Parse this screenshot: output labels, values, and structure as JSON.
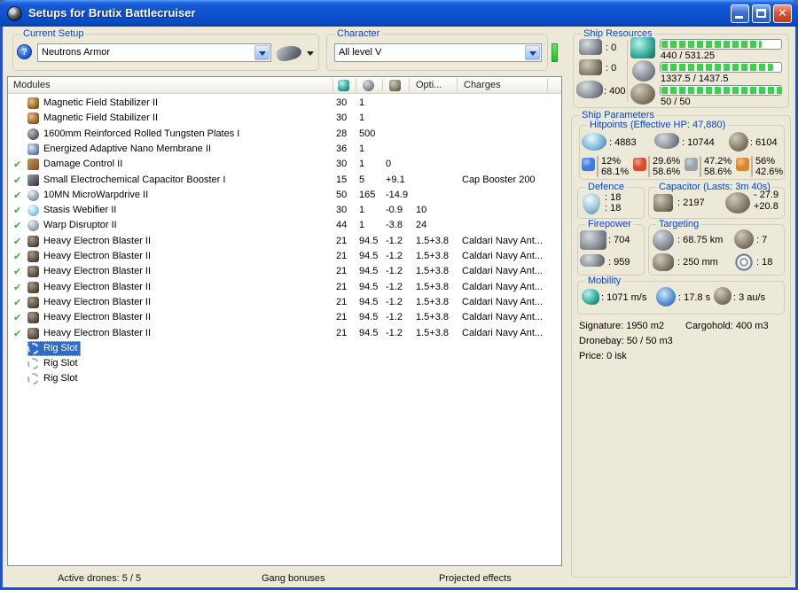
{
  "colors": {
    "selection": "#316ac5",
    "bar_green": "#3ed04a",
    "titlebar_blue": "#0f52d0",
    "close_red": "#dd5436",
    "indicator_green": "#2fd432"
  },
  "titlebar": {
    "title": "Setups for Brutix Battlecruiser"
  },
  "current_setup": {
    "label": "Current Setup",
    "value": "Neutrons Armor"
  },
  "character": {
    "label": "Character",
    "value": "All level V"
  },
  "modules": {
    "title": "Modules",
    "columns": {
      "opti": "Opti...",
      "charges": "Charges"
    },
    "rows": [
      {
        "icon": "magnetic-field-stabilizer",
        "name": "Magnetic Field Stabilizer II",
        "cpu": "30",
        "pg": "1",
        "active": false
      },
      {
        "icon": "magnetic-field-stabilizer",
        "name": "Magnetic Field Stabilizer II",
        "cpu": "30",
        "pg": "1",
        "active": false
      },
      {
        "icon": "armor-plate",
        "name": "1600mm Reinforced Rolled Tungsten Plates I",
        "cpu": "28",
        "pg": "500",
        "active": false
      },
      {
        "icon": "energized-membrane",
        "name": "Energized Adaptive Nano Membrane II",
        "cpu": "36",
        "pg": "1",
        "active": false
      },
      {
        "icon": "damage-control",
        "name": "Damage Control II",
        "cpu": "30",
        "pg": "1",
        "cap": "0",
        "active": true
      },
      {
        "icon": "cap-booster",
        "name": "Small Electrochemical Capacitor Booster I",
        "cpu": "15",
        "pg": "5",
        "cap": "+9.1",
        "charges": "Cap Booster 200",
        "active": true
      },
      {
        "icon": "microwarpdrive",
        "name": "10MN MicroWarpdrive II",
        "cpu": "50",
        "pg": "165",
        "cap": "-14.9",
        "active": true
      },
      {
        "icon": "stasis-webifier",
        "name": "Stasis Webifier II",
        "cpu": "30",
        "pg": "1",
        "cap": "-0.9",
        "opti": "10",
        "active": true
      },
      {
        "icon": "warp-disruptor",
        "name": "Warp Disruptor II",
        "cpu": "44",
        "pg": "1",
        "cap": "-3.8",
        "opti": "24",
        "active": true
      },
      {
        "icon": "blaster",
        "name": "Heavy Electron Blaster II",
        "cpu": "21",
        "pg": "94.5",
        "cap": "-1.2",
        "opti": "1.5+3.8",
        "charges": "Caldari Navy Ant...",
        "active": true
      },
      {
        "icon": "blaster",
        "name": "Heavy Electron Blaster II",
        "cpu": "21",
        "pg": "94.5",
        "cap": "-1.2",
        "opti": "1.5+3.8",
        "charges": "Caldari Navy Ant...",
        "active": true
      },
      {
        "icon": "blaster",
        "name": "Heavy Electron Blaster II",
        "cpu": "21",
        "pg": "94.5",
        "cap": "-1.2",
        "opti": "1.5+3.8",
        "charges": "Caldari Navy Ant...",
        "active": true
      },
      {
        "icon": "blaster",
        "name": "Heavy Electron Blaster II",
        "cpu": "21",
        "pg": "94.5",
        "cap": "-1.2",
        "opti": "1.5+3.8",
        "charges": "Caldari Navy Ant...",
        "active": true
      },
      {
        "icon": "blaster",
        "name": "Heavy Electron Blaster II",
        "cpu": "21",
        "pg": "94.5",
        "cap": "-1.2",
        "opti": "1.5+3.8",
        "charges": "Caldari Navy Ant...",
        "active": true
      },
      {
        "icon": "blaster",
        "name": "Heavy Electron Blaster II",
        "cpu": "21",
        "pg": "94.5",
        "cap": "-1.2",
        "opti": "1.5+3.8",
        "charges": "Caldari Navy Ant...",
        "active": true
      },
      {
        "icon": "blaster",
        "name": "Heavy Electron Blaster II",
        "cpu": "21",
        "pg": "94.5",
        "cap": "-1.2",
        "opti": "1.5+3.8",
        "charges": "Caldari Navy Ant...",
        "active": true
      },
      {
        "icon": "rig-slot",
        "name": "Rig Slot",
        "active": false,
        "selected": true
      },
      {
        "icon": "rig-slot",
        "name": "Rig Slot",
        "active": false
      },
      {
        "icon": "rig-slot",
        "name": "Rig Slot",
        "active": false
      }
    ]
  },
  "footer": {
    "active_drones": "Active drones: 5 / 5",
    "gang_bonuses": "Gang bonuses",
    "projected_effects": "Projected effects"
  },
  "ship_resources": {
    "label": "Ship Resources",
    "turrets": ": 0",
    "launchers": ": 0",
    "calibration": ": 400",
    "cpu": {
      "text": "440 / 531.25",
      "pct": 83
    },
    "powergrid": {
      "text": "1337.5 / 1437.5",
      "pct": 93
    },
    "drone_bandwidth": {
      "text": "50 / 50",
      "pct": 100
    }
  },
  "ship_parameters": {
    "label": "Ship Parameters",
    "hitpoints": {
      "label": "Hitpoints (Effective HP: 47,880)",
      "shield": ": 4883",
      "armor": ": 10744",
      "structure": ": 6104",
      "resists": [
        {
          "type": "em",
          "color": "#3f7ce0",
          "top": "12%",
          "bottom": "68.1%"
        },
        {
          "type": "thermal",
          "color": "#e04a2a",
          "top": "29.6%",
          "bottom": "58.6%"
        },
        {
          "type": "kinetic",
          "color": "#9aa2ac",
          "top": "47.2%",
          "bottom": "58.6%"
        },
        {
          "type": "explosive",
          "color": "#e08428",
          "top": "56%",
          "bottom": "42.6%"
        }
      ]
    },
    "defence": {
      "label": "Defence",
      "value1": ": 18",
      "value2": ": 18"
    },
    "capacitor": {
      "label": "Capacitor (Lasts: 3m 40s)",
      "amount": ": 2197",
      "drain": "- 27.9",
      "recharge": "+20.8"
    },
    "firepower": {
      "label": "Firepower",
      "dps": ": 704",
      "volley": ": 959"
    },
    "targeting": {
      "label": "Targeting",
      "range": ": 68.75 km",
      "max_targets": ": 7",
      "scan_resolution": ": 250 mm",
      "sensor_strength": ": 18"
    },
    "mobility": {
      "label": "Mobility",
      "speed": ": 1071 m/s",
      "align_time": ": 17.8 s",
      "warp_speed": ": 3 au/s"
    },
    "stats": {
      "signature": "Signature: 1950 m2",
      "cargohold": "Cargohold: 400 m3",
      "dronebay": "Dronebay: 50 / 50 m3",
      "price": "Price: 0 isk"
    }
  }
}
